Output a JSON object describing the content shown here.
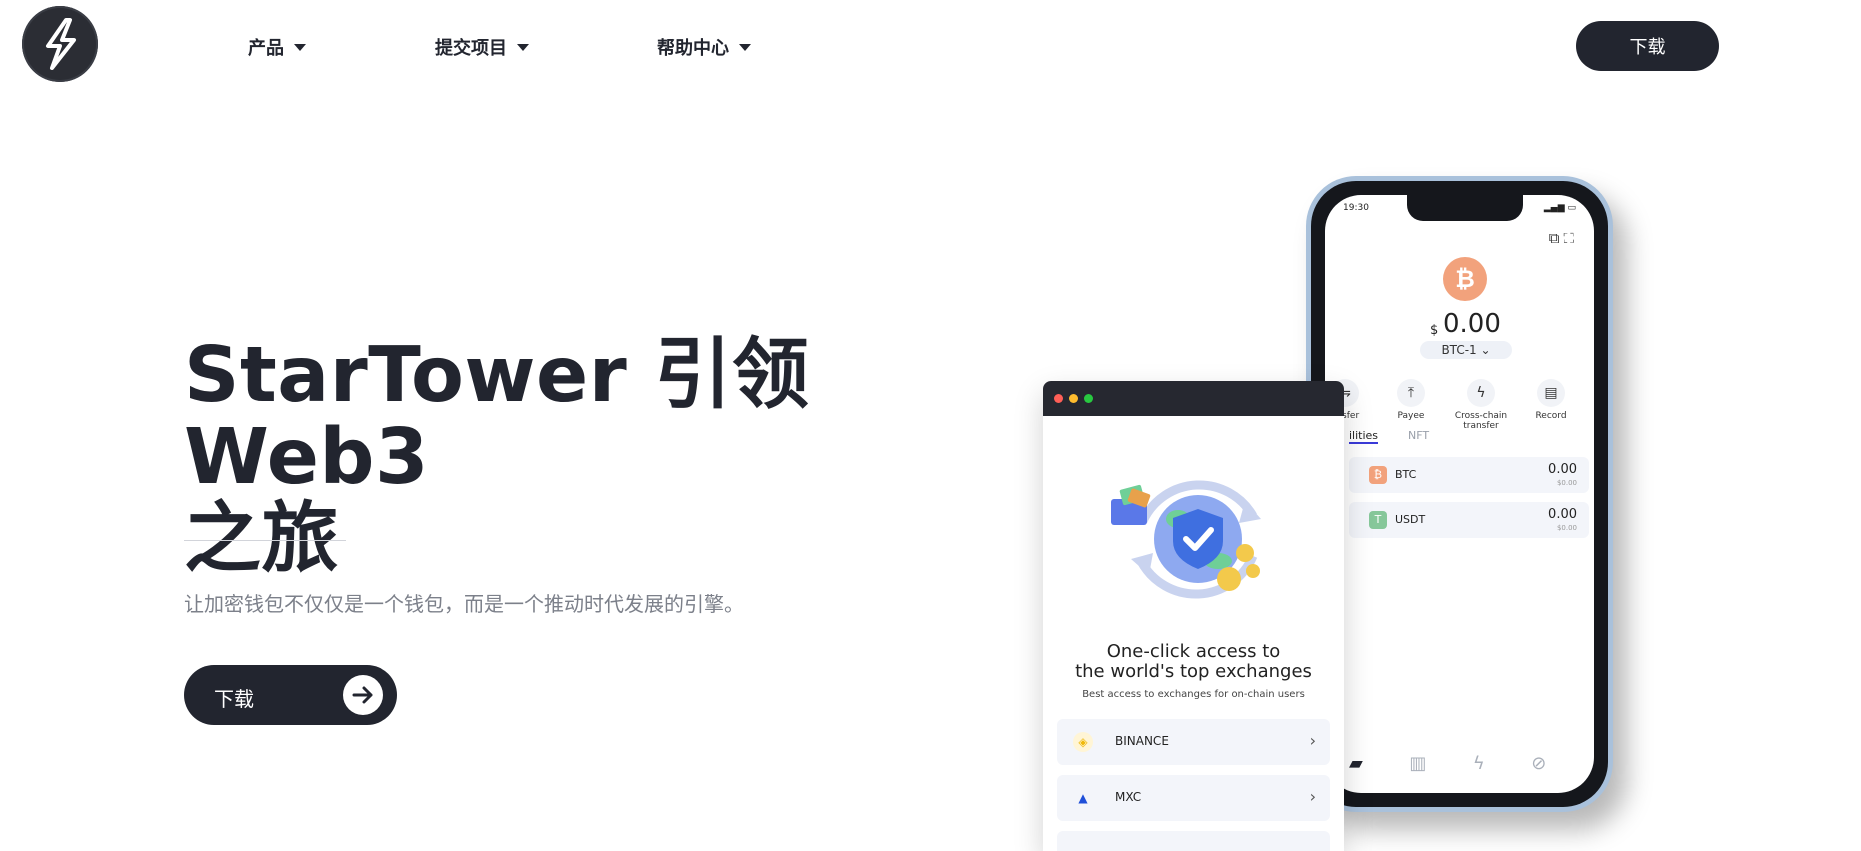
{
  "nav": {
    "items": [
      {
        "label": "产品"
      },
      {
        "label": "提交项目"
      },
      {
        "label": "帮助中心"
      }
    ],
    "download_label": "下载"
  },
  "hero": {
    "title_line1": "StarTower 引领 Web3",
    "title_line2": "之旅",
    "subtitle": "让加密钱包不仅仅是一个钱包，而是一个推动时代发展的引擎。",
    "download_label": "下载"
  },
  "phone": {
    "time": "19:30",
    "balance_currency": "$",
    "balance": "0.00",
    "account": "BTC-1",
    "actions": [
      "ansfer",
      "Payee",
      "Cross-chain transfer",
      "Record"
    ],
    "tabs": [
      "ilities",
      "NFT"
    ],
    "assets": [
      {
        "symbol": "BTC",
        "amount": "0.00",
        "usd": "$0.00",
        "color": "#f2a27c",
        "glyph": "₿"
      },
      {
        "symbol": "USDT",
        "amount": "0.00",
        "usd": "$0.00",
        "color": "#86c79a",
        "glyph": "T"
      }
    ]
  },
  "window": {
    "title_line1": "One-click access to",
    "title_line2": "the world's top exchanges",
    "subtitle": "Best access to exchanges for on-chain users",
    "exchanges": [
      {
        "name": "BINANCE",
        "icon": "binance-icon"
      },
      {
        "name": "MXC",
        "icon": "mxc-icon"
      }
    ]
  },
  "colors": {
    "primary_dark": "#22252f",
    "subtitle_gray": "#7c808a",
    "btc_orange": "#f2a27c",
    "usdt_green": "#86c79a",
    "phone_frame": "#a9c1db"
  }
}
